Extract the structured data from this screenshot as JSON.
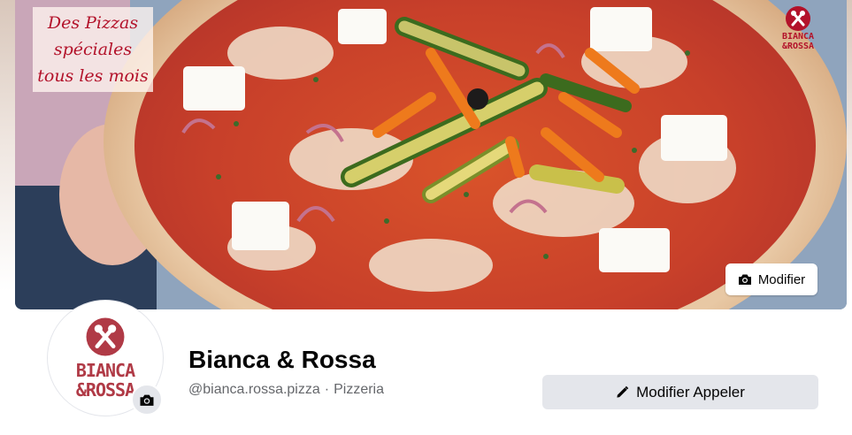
{
  "cover": {
    "promo_lines": [
      "Des Pizzas",
      "spéciales",
      "tous les mois"
    ],
    "logo_text_line1": "BIANCA",
    "logo_text_line2": "&ROSSA",
    "edit_button_label": "Modifier",
    "edit_icon": "camera-icon"
  },
  "profile": {
    "name": "Bianca & Rossa",
    "handle": "@bianca.rossa.pizza",
    "separator": "·",
    "category": "Pizzeria",
    "logo_line1": "BIANCA",
    "logo_line2": "&ROSSA",
    "avatar_edit_icon": "camera-icon"
  },
  "actions": {
    "primary_label": "Modifier Appeler",
    "primary_icon": "pencil-icon"
  },
  "colors": {
    "brand_red": "#b3122a",
    "button_gray": "#e4e6eb",
    "text_primary": "#050505",
    "text_secondary": "#65676b"
  }
}
